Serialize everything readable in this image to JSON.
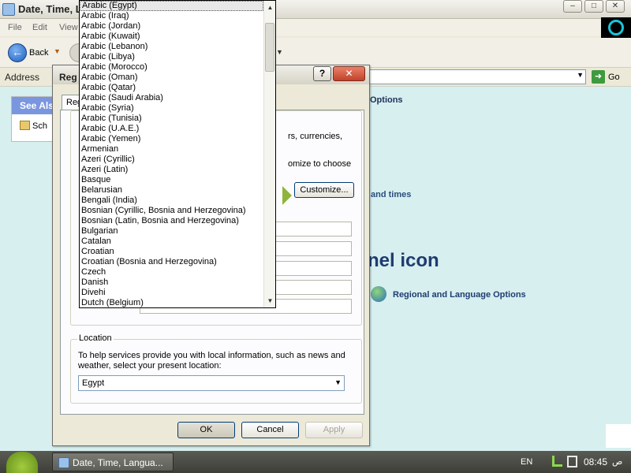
{
  "explorer": {
    "title": "Date, Time, L",
    "menu": [
      "File",
      "Edit",
      "View"
    ],
    "toolbar": {
      "back_label": "Back"
    },
    "address": {
      "label": "Address",
      "go_label": "Go"
    },
    "see_also": {
      "heading": "See Als",
      "item": "Sch"
    },
    "pick_category": "Options",
    "category_dates": "and times",
    "panel_icon_heading": "nel icon",
    "regional_link": "Regional and Language Options"
  },
  "dialog": {
    "title": "Reg",
    "tab": "Reg",
    "standards_text_1": "rs, currencies,",
    "standards_text_2": "omize to choose",
    "customize_label": "Customize...",
    "location_legend": "Location",
    "location_description": "To help services provide you with local information, such as news and weather, select your present location:",
    "location_value": "Egypt",
    "ok_label": "OK",
    "cancel_label": "Cancel",
    "apply_label": "Apply"
  },
  "dropdown": {
    "items": [
      "Arabic (Egypt)",
      "Arabic (Iraq)",
      "Arabic (Jordan)",
      "Arabic (Kuwait)",
      "Arabic (Lebanon)",
      "Arabic (Libya)",
      "Arabic (Morocco)",
      "Arabic (Oman)",
      "Arabic (Qatar)",
      "Arabic (Saudi Arabia)",
      "Arabic (Syria)",
      "Arabic (Tunisia)",
      "Arabic (U.A.E.)",
      "Arabic (Yemen)",
      "Armenian",
      "Azeri (Cyrillic)",
      "Azeri (Latin)",
      "Basque",
      "Belarusian",
      "Bengali (India)",
      "Bosnian (Cyrillic, Bosnia and Herzegovina)",
      "Bosnian (Latin, Bosnia and Herzegovina)",
      "Bulgarian",
      "Catalan",
      "Croatian",
      "Croatian (Bosnia and Herzegovina)",
      "Czech",
      "Danish",
      "Divehi",
      "Dutch (Belgium)"
    ]
  },
  "taskbar": {
    "task_label": "Date, Time, Langua...",
    "language": "EN",
    "time": "08:45",
    "ampm": "ص"
  }
}
